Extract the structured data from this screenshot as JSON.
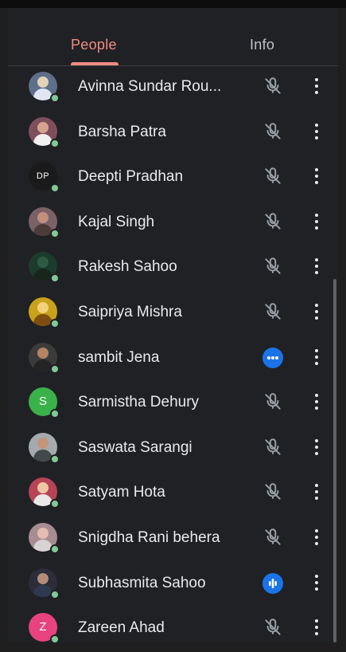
{
  "tabs": {
    "people": "People",
    "info": "Info"
  },
  "colors": {
    "accent": "#f28b82",
    "background": "#202124",
    "presence": "#81c995",
    "active_speaker": "#1a73e8",
    "text": "#e8eaed"
  },
  "participants": [
    {
      "name": "Avinna Sundar Rou...",
      "avatar": "photo",
      "status": "mic-off-icon"
    },
    {
      "name": "Barsha Patra",
      "avatar": "photo",
      "status": "mic-off-icon"
    },
    {
      "name": "Deepti Pradhan",
      "avatar": "initials",
      "initials": "DP",
      "status": "mic-off-icon"
    },
    {
      "name": "Kajal Singh",
      "avatar": "photo",
      "status": "mic-off-icon"
    },
    {
      "name": "Rakesh Sahoo",
      "avatar": "photo",
      "status": "mic-off-icon"
    },
    {
      "name": "Saipriya Mishra",
      "avatar": "photo",
      "status": "mic-off-icon"
    },
    {
      "name": "sambit Jena",
      "avatar": "photo",
      "status": "more-horiz-icon"
    },
    {
      "name": "Sarmistha Dehury",
      "avatar": "initials",
      "initials": "S",
      "status": "mic-off-icon"
    },
    {
      "name": "Saswata Sarangi",
      "avatar": "photo",
      "status": "mic-off-icon"
    },
    {
      "name": "Satyam Hota",
      "avatar": "photo",
      "status": "mic-off-icon"
    },
    {
      "name": "Snigdha Rani behera",
      "avatar": "photo",
      "status": "mic-off-icon"
    },
    {
      "name": "Subhasmita Sahoo",
      "avatar": "photo",
      "status": "audio-bars-icon"
    },
    {
      "name": "Zareen Ahad",
      "avatar": "initials",
      "initials": "Z",
      "status": "mic-off-icon"
    }
  ]
}
